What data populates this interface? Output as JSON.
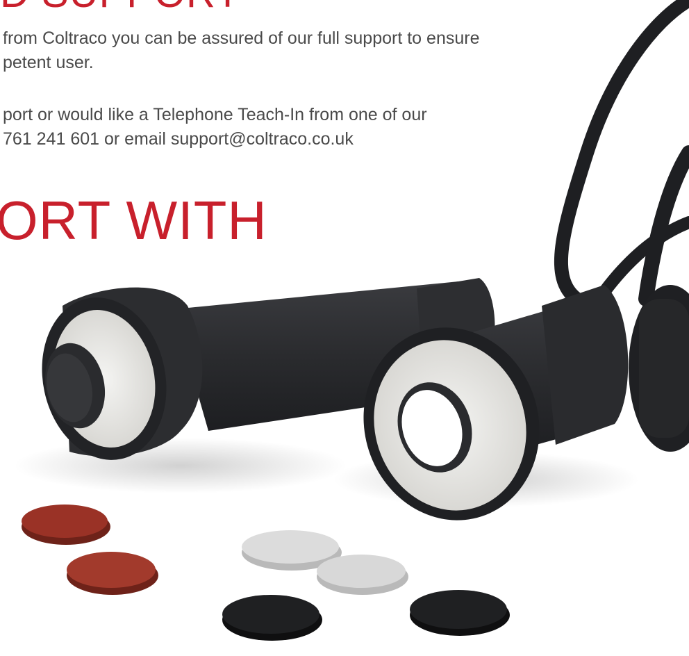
{
  "heading_top": {
    "text": "D SUPPORT"
  },
  "intro": {
    "line1": "from Coltraco you can be assured of our full support to ensure",
    "line2": "petent user."
  },
  "contact": {
    "line1": "port or would like a Telephone Teach-In from one of our",
    "line2": "761 241 601 or email support@coltraco.co.uk"
  },
  "heading_mid": {
    "text": "ORT WITH"
  },
  "colors": {
    "heading": "#c8202c",
    "body_text": "#4a4a4a",
    "product": "#2b2c2f",
    "disc_red": "#9a3226",
    "disc_grey": "#d6d6d6",
    "disc_black": "#1c1c1e"
  }
}
